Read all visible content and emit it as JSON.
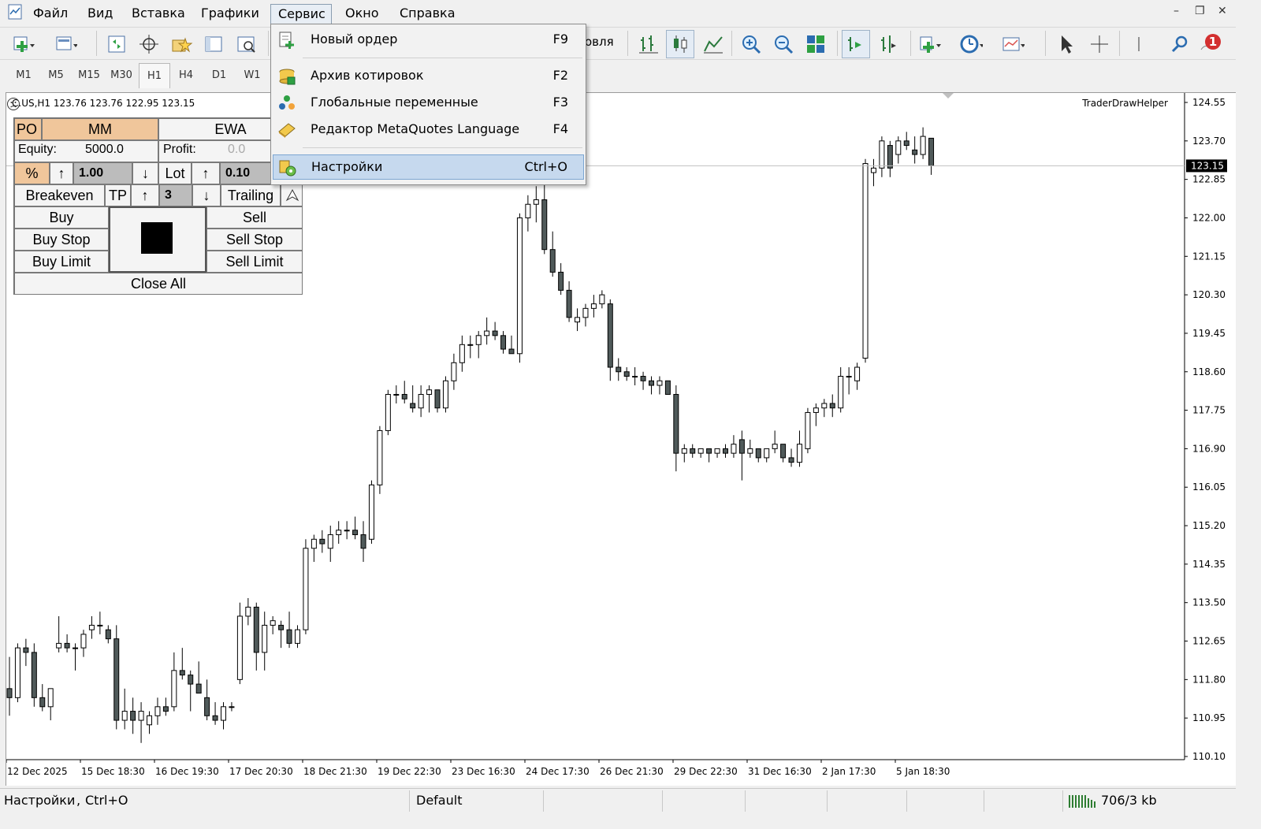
{
  "menu": {
    "items": [
      "Файл",
      "Вид",
      "Вставка",
      "Графики",
      "Сервис",
      "Окно",
      "Справка"
    ],
    "active": "Сервис"
  },
  "toolbar": {
    "partial_label": "овля",
    "notification_count": "1"
  },
  "timeframes": [
    "M1",
    "M5",
    "M15",
    "M30",
    "H1",
    "H4",
    "D1",
    "W1"
  ],
  "timeframe_active": "H1",
  "dropdown": {
    "items": [
      {
        "label": "Новый ордер",
        "shortcut": "F9",
        "icon": "new-order-icon"
      },
      {
        "label": "Архив котировок",
        "shortcut": "F2",
        "icon": "history-center-icon"
      },
      {
        "label": "Глобальные переменные",
        "shortcut": "F3",
        "icon": "global-variables-icon"
      },
      {
        "label": "Редактор MetaQuotes Language",
        "shortcut": "F4",
        "icon": "metaeditor-icon"
      },
      {
        "label": "Настройки",
        "shortcut": "Ctrl+O",
        "icon": "settings-icon"
      }
    ],
    "highlighted": "Настройки"
  },
  "chart_info": "C.US,H1  123.76 123.76 122.95 123.15",
  "indicator_name": "TraderDrawHelper",
  "panel": {
    "po": "PO",
    "mm": "MM",
    "ewa": "EWA",
    "equity_label": "Equity:",
    "equity_value": "5000.0",
    "profit_label": "Profit:",
    "profit_value": "0.0",
    "percent": "%",
    "up_arrow": "↑",
    "down_arrow": "↓",
    "risk_value": "1.00",
    "lot_label": "Lot",
    "lot_value": "0.10",
    "breakeven": "Breakeven",
    "tp": "TP",
    "tp_value": "3",
    "trailing": "Trailing",
    "buy": "Buy",
    "sell": "Sell",
    "buy_stop": "Buy Stop",
    "sell_stop": "Sell Stop",
    "buy_limit": "Buy Limit",
    "sell_limit": "Sell Limit",
    "close_all": "Close All"
  },
  "price_axis": {
    "labels": [
      "124.55",
      "123.70",
      "122.85",
      "122.00",
      "121.15",
      "120.30",
      "119.45",
      "118.60",
      "117.75",
      "116.90",
      "116.05",
      "115.20",
      "114.35",
      "113.50",
      "112.65",
      "111.80",
      "110.95",
      "110.10"
    ],
    "current_price": "123.15"
  },
  "time_axis": [
    "12 Dec 2025",
    "15 Dec 18:30",
    "16 Dec 19:30",
    "17 Dec 20:30",
    "18 Dec 21:30",
    "19 Dec 22:30",
    "23 Dec 16:30",
    "24 Dec 17:30",
    "26 Dec 21:30",
    "29 Dec 22:30",
    "31 Dec 16:30",
    "2 Jan 17:30",
    "5 Jan 18:30"
  ],
  "chart_data": {
    "type": "candlestick",
    "symbol": "C.US",
    "timeframe": "H1",
    "ylim": [
      110.1,
      124.55
    ],
    "last_price": 123.15,
    "candles": [
      [
        111.6,
        112.3,
        111.0,
        111.4
      ],
      [
        111.4,
        112.6,
        111.3,
        112.5
      ],
      [
        112.5,
        112.7,
        112.1,
        112.4
      ],
      [
        112.4,
        112.6,
        111.2,
        111.4
      ],
      [
        111.4,
        111.7,
        111.1,
        111.2
      ],
      [
        111.2,
        111.6,
        110.9,
        111.6
      ],
      [
        112.5,
        113.2,
        112.4,
        112.6
      ],
      [
        112.6,
        112.8,
        112.4,
        112.5
      ],
      [
        112.5,
        112.6,
        112.0,
        112.5
      ],
      [
        112.5,
        112.9,
        112.3,
        112.8
      ],
      [
        112.9,
        113.2,
        112.7,
        113.0
      ],
      [
        113.0,
        113.3,
        112.8,
        113.0
      ],
      [
        112.9,
        113.0,
        112.6,
        112.7
      ],
      [
        112.7,
        113.0,
        110.7,
        110.9
      ],
      [
        110.9,
        111.6,
        110.7,
        111.1
      ],
      [
        111.1,
        111.4,
        110.6,
        110.9
      ],
      [
        110.9,
        111.3,
        110.4,
        111.1
      ],
      [
        110.8,
        111.1,
        110.6,
        111.0
      ],
      [
        111.0,
        111.4,
        110.8,
        111.2
      ],
      [
        111.2,
        111.4,
        111.0,
        111.1
      ],
      [
        111.2,
        112.4,
        111.1,
        112.0
      ],
      [
        112.0,
        112.5,
        111.8,
        111.9
      ],
      [
        111.9,
        112.0,
        111.1,
        111.7
      ],
      [
        111.7,
        112.2,
        111.5,
        111.5
      ],
      [
        111.4,
        111.8,
        110.9,
        111.0
      ],
      [
        111.0,
        111.3,
        110.8,
        110.9
      ],
      [
        110.9,
        111.3,
        110.7,
        111.2
      ],
      [
        111.2,
        111.3,
        111.1,
        111.2
      ],
      [
        111.8,
        113.5,
        111.7,
        113.2
      ],
      [
        113.2,
        113.6,
        113.0,
        113.4
      ],
      [
        113.4,
        113.5,
        112.0,
        112.4
      ],
      [
        112.4,
        113.3,
        112.0,
        113.0
      ],
      [
        113.0,
        113.2,
        112.8,
        113.1
      ],
      [
        113.0,
        113.1,
        112.5,
        112.9
      ],
      [
        112.9,
        113.3,
        112.5,
        112.6
      ],
      [
        112.6,
        113.0,
        112.5,
        112.9
      ],
      [
        112.9,
        114.9,
        112.8,
        114.7
      ],
      [
        114.7,
        115.0,
        114.4,
        114.9
      ],
      [
        114.9,
        115.1,
        114.6,
        114.8
      ],
      [
        114.7,
        115.2,
        114.4,
        115.0
      ],
      [
        115.0,
        115.3,
        114.8,
        115.1
      ],
      [
        115.1,
        115.3,
        114.9,
        115.1
      ],
      [
        115.1,
        115.4,
        114.9,
        115.0
      ],
      [
        115.0,
        115.3,
        114.4,
        114.7
      ],
      [
        114.9,
        116.2,
        114.8,
        116.1
      ],
      [
        116.1,
        117.4,
        115.9,
        117.3
      ],
      [
        117.3,
        118.2,
        117.2,
        118.1
      ],
      [
        118.1,
        118.3,
        117.9,
        118.1
      ],
      [
        118.1,
        118.4,
        117.9,
        118.0
      ],
      [
        117.9,
        118.3,
        117.7,
        117.8
      ],
      [
        117.8,
        118.3,
        117.6,
        118.1
      ],
      [
        118.1,
        118.3,
        117.7,
        118.2
      ],
      [
        118.2,
        118.2,
        117.7,
        117.8
      ],
      [
        117.8,
        118.5,
        117.7,
        118.4
      ],
      [
        118.4,
        119.0,
        118.2,
        118.8
      ],
      [
        118.8,
        119.4,
        118.6,
        119.2
      ],
      [
        119.2,
        119.4,
        118.9,
        119.2
      ],
      [
        119.2,
        119.5,
        118.9,
        119.4
      ],
      [
        119.4,
        119.8,
        119.2,
        119.5
      ],
      [
        119.5,
        119.7,
        119.3,
        119.4
      ],
      [
        119.4,
        119.5,
        119.0,
        119.1
      ],
      [
        119.1,
        119.4,
        119.0,
        119.0
      ],
      [
        119.0,
        122.1,
        118.8,
        122.0
      ],
      [
        122.0,
        122.5,
        121.7,
        122.3
      ],
      [
        122.3,
        122.7,
        121.9,
        122.4
      ],
      [
        122.4,
        122.8,
        121.2,
        121.3
      ],
      [
        121.3,
        121.7,
        120.7,
        120.8
      ],
      [
        120.8,
        121.0,
        120.3,
        120.4
      ],
      [
        120.4,
        120.6,
        119.7,
        119.8
      ],
      [
        119.7,
        120.0,
        119.5,
        119.8
      ],
      [
        119.8,
        120.1,
        119.6,
        120.0
      ],
      [
        120.0,
        120.3,
        119.8,
        120.1
      ],
      [
        120.1,
        120.4,
        120.0,
        120.3
      ],
      [
        120.1,
        120.2,
        118.4,
        118.7
      ],
      [
        118.7,
        118.9,
        118.4,
        118.6
      ],
      [
        118.6,
        118.7,
        118.4,
        118.5
      ],
      [
        118.5,
        118.7,
        118.3,
        118.5
      ],
      [
        118.5,
        118.6,
        118.2,
        118.4
      ],
      [
        118.4,
        118.5,
        118.1,
        118.3
      ],
      [
        118.3,
        118.5,
        118.1,
        118.4
      ],
      [
        118.4,
        118.4,
        118.1,
        118.1
      ],
      [
        118.1,
        118.3,
        116.4,
        116.8
      ],
      [
        116.8,
        117.0,
        116.6,
        116.9
      ],
      [
        116.9,
        117.0,
        116.7,
        116.8
      ],
      [
        116.8,
        116.9,
        116.7,
        116.9
      ],
      [
        116.9,
        116.9,
        116.6,
        116.8
      ],
      [
        116.8,
        116.9,
        116.7,
        116.9
      ],
      [
        116.9,
        117.0,
        116.7,
        116.8
      ],
      [
        116.8,
        117.2,
        116.7,
        117.0
      ],
      [
        117.1,
        117.3,
        116.2,
        116.8
      ],
      [
        116.8,
        117.1,
        116.7,
        116.9
      ],
      [
        116.9,
        116.9,
        116.6,
        116.7
      ],
      [
        116.7,
        116.9,
        116.6,
        116.9
      ],
      [
        116.9,
        117.3,
        116.8,
        117.0
      ],
      [
        117.0,
        117.0,
        116.6,
        116.7
      ],
      [
        116.7,
        116.9,
        116.5,
        116.6
      ],
      [
        116.6,
        117.3,
        116.5,
        117.0
      ],
      [
        116.9,
        117.8,
        116.8,
        117.7
      ],
      [
        117.7,
        117.9,
        117.4,
        117.8
      ],
      [
        117.8,
        118.0,
        117.6,
        117.9
      ],
      [
        117.9,
        118.1,
        117.6,
        117.8
      ],
      [
        117.8,
        118.7,
        117.7,
        118.5
      ],
      [
        118.5,
        118.7,
        118.1,
        118.5
      ],
      [
        118.4,
        118.8,
        118.2,
        118.7
      ],
      [
        118.9,
        123.3,
        118.8,
        123.2
      ],
      [
        123.0,
        123.3,
        122.7,
        123.1
      ],
      [
        123.1,
        123.8,
        122.9,
        123.7
      ],
      [
        123.6,
        123.7,
        122.9,
        123.1
      ],
      [
        123.4,
        123.8,
        123.2,
        123.7
      ],
      [
        123.7,
        123.9,
        123.5,
        123.6
      ],
      [
        123.5,
        123.8,
        123.2,
        123.4
      ],
      [
        123.4,
        124.0,
        123.3,
        123.8
      ],
      [
        123.76,
        123.76,
        122.95,
        123.15
      ]
    ]
  }
}
